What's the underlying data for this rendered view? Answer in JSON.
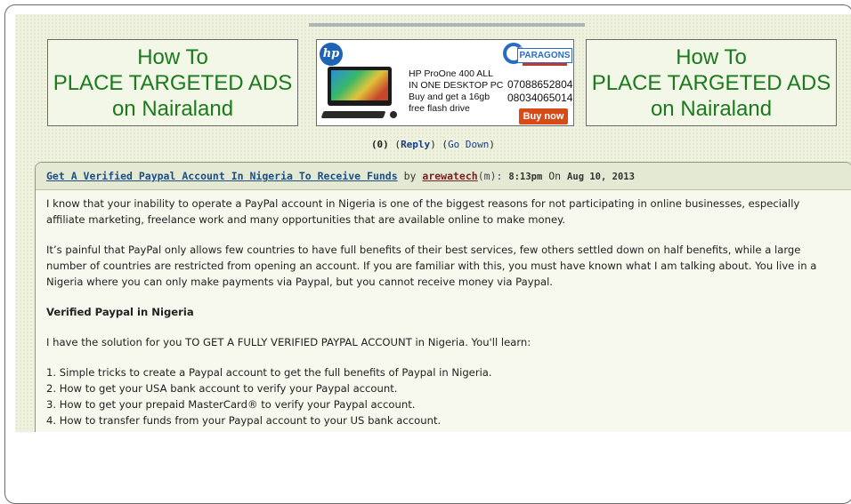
{
  "ads": {
    "left": {
      "line1": "How To",
      "line2": "PLACE TARGETED ADS",
      "line3": "on Nairaland"
    },
    "right": {
      "line1": "How To",
      "line2": "PLACE TARGETED ADS",
      "line3": "on Nairaland"
    },
    "hp": {
      "logo": "hp",
      "brand": "PARAGONS",
      "desc1": "HP ProOne 400 ALL",
      "desc2": "IN ONE  DESKTOP PC",
      "desc3": "Buy and get a 16gb",
      "desc4": "free flash drive",
      "phone1": "07088652804",
      "phone2": "08034065014",
      "cta": "Buy now"
    }
  },
  "reply_bar": {
    "count": "(0)",
    "reply": "Reply",
    "go_down": "Go Down"
  },
  "post": {
    "title": "Get A Verified Paypal Account In Nigeria To Receive Funds",
    "by": "by",
    "author": "arewatech",
    "author_suffix": "m",
    "time": "8:13pm",
    "on": "On",
    "date": "Aug 10, 2013",
    "para1": "I know that your inability to operate a PayPal account in Nigeria is one of the biggest reasons for not participating in online businesses, especially affiliate marketing, freelance work and many opportunities that are available online to make money.",
    "para2": "It’s painful that PayPal only allows few countries to have full benefits of their best services, few others settled down on half benefits, while a large number of countries are restricted from opening an account. If you are familiar with this, you must have known what I am talking about. You live in a Nigeria where you can only make payments via Paypal, but you cannot receive money via Paypal.",
    "subheading": "Verified Paypal in Nigeria",
    "para3": "I have the solution for you TO GET A FULLY VERIFIED PAYPAL ACCOUNT in Nigeria. You'll learn:",
    "list": [
      "1. Simple tricks to create a Paypal account to get the full benefits of Paypal in Nigeria.",
      "2. How to get your USA bank account to verify your Paypal account.",
      "3. How to get your prepaid MasterCard® to verify your Paypal account.",
      "4. How to transfer funds from your Paypal account to your US bank account."
    ]
  }
}
